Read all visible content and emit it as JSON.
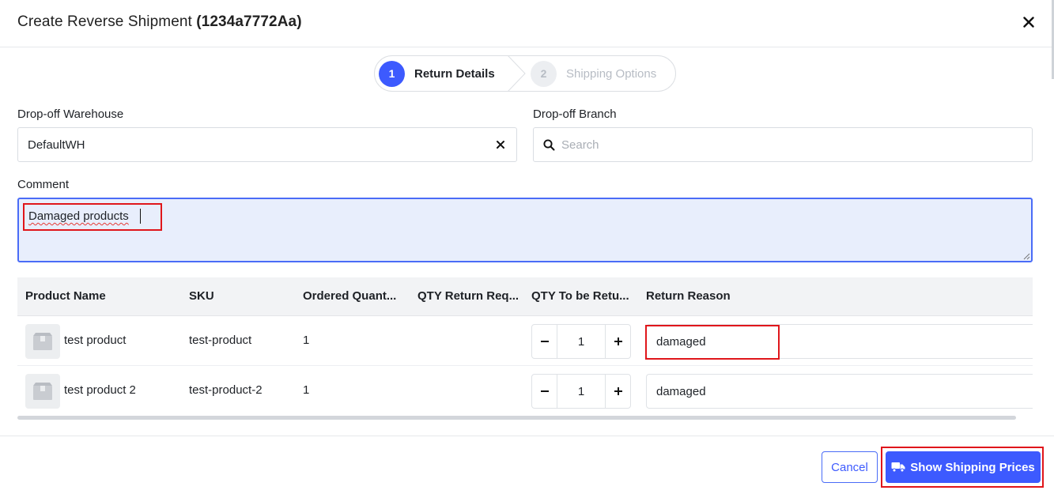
{
  "header": {
    "title_prefix": "Create Reverse Shipment",
    "title_id": "(1234a7772Aa)"
  },
  "stepper": {
    "steps": [
      {
        "number": "1",
        "label": "Return Details",
        "active": true
      },
      {
        "number": "2",
        "label": "Shipping Options",
        "active": false
      }
    ]
  },
  "form": {
    "warehouse_label": "Drop-off Warehouse",
    "warehouse_value": "DefaultWH",
    "branch_label": "Drop-off Branch",
    "branch_placeholder": "Search",
    "comment_label": "Comment",
    "comment_value": "Damaged products"
  },
  "table": {
    "columns": [
      "Product Name",
      "SKU",
      "Ordered Quant...",
      "QTY Return Req...",
      "QTY To be Retu...",
      "Return Reason"
    ],
    "rows": [
      {
        "name": "test product",
        "sku": "test-product",
        "ordered": "1",
        "return_req": "",
        "qty": "1",
        "reason": "damaged"
      },
      {
        "name": "test product 2",
        "sku": "test-product-2",
        "ordered": "1",
        "return_req": "",
        "qty": "1",
        "reason": "damaged"
      }
    ]
  },
  "footer": {
    "cancel_label": "Cancel",
    "submit_label": "Show Shipping Prices"
  },
  "icons": {
    "close": "close-icon",
    "clear": "clear-icon",
    "search": "search-icon",
    "product": "product-placeholder-icon",
    "truck": "truck-icon"
  },
  "colors": {
    "primary": "#3d5afe",
    "highlight": "#e0161b",
    "comment_bg": "#e8eefc"
  }
}
